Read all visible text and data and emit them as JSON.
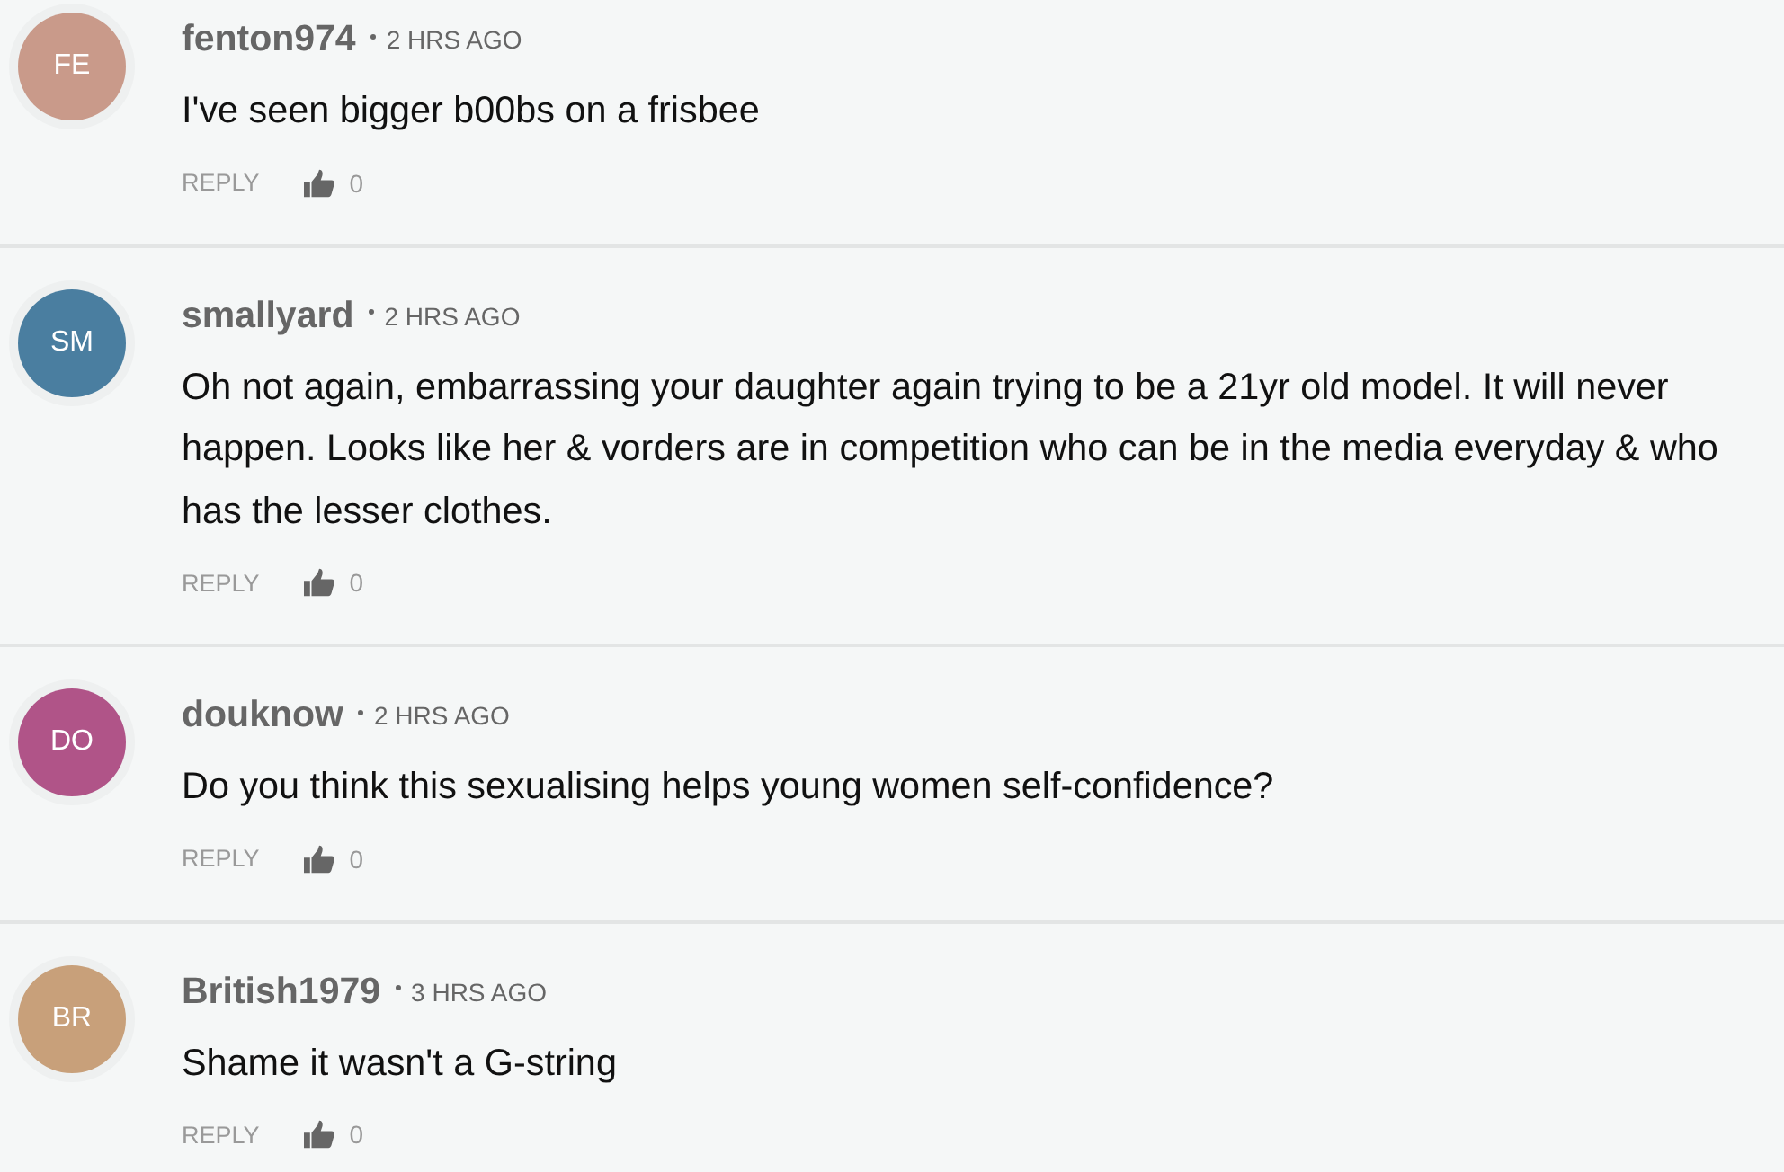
{
  "comments": [
    {
      "initials": "FE",
      "color": "#c99a8a",
      "username": "fenton974",
      "time": "2 HRS AGO",
      "text": "I've seen bigger b00bs on a frisbee",
      "reply": "REPLY",
      "likes": "0"
    },
    {
      "initials": "SM",
      "color": "#4a7ea0",
      "username": "smallyard",
      "time": "2 HRS AGO",
      "text": "Oh not again, embarrassing your daughter again trying to be a 21yr old model. It will never happen. Looks like her & vorders are in competition who can be in the media everyday & who has the lesser clothes.",
      "reply": "REPLY",
      "likes": "0"
    },
    {
      "initials": "DO",
      "color": "#b05488",
      "username": "douknow",
      "time": "2 HRS AGO",
      "text": "Do you think this sexualising helps young women self-confidence?",
      "reply": "REPLY",
      "likes": "0"
    },
    {
      "initials": "BR",
      "color": "#c8a07a",
      "username": "British1979",
      "time": "3 HRS AGO",
      "text": "Shame it wasn't a G-string",
      "reply": "REPLY",
      "likes": "0"
    }
  ]
}
